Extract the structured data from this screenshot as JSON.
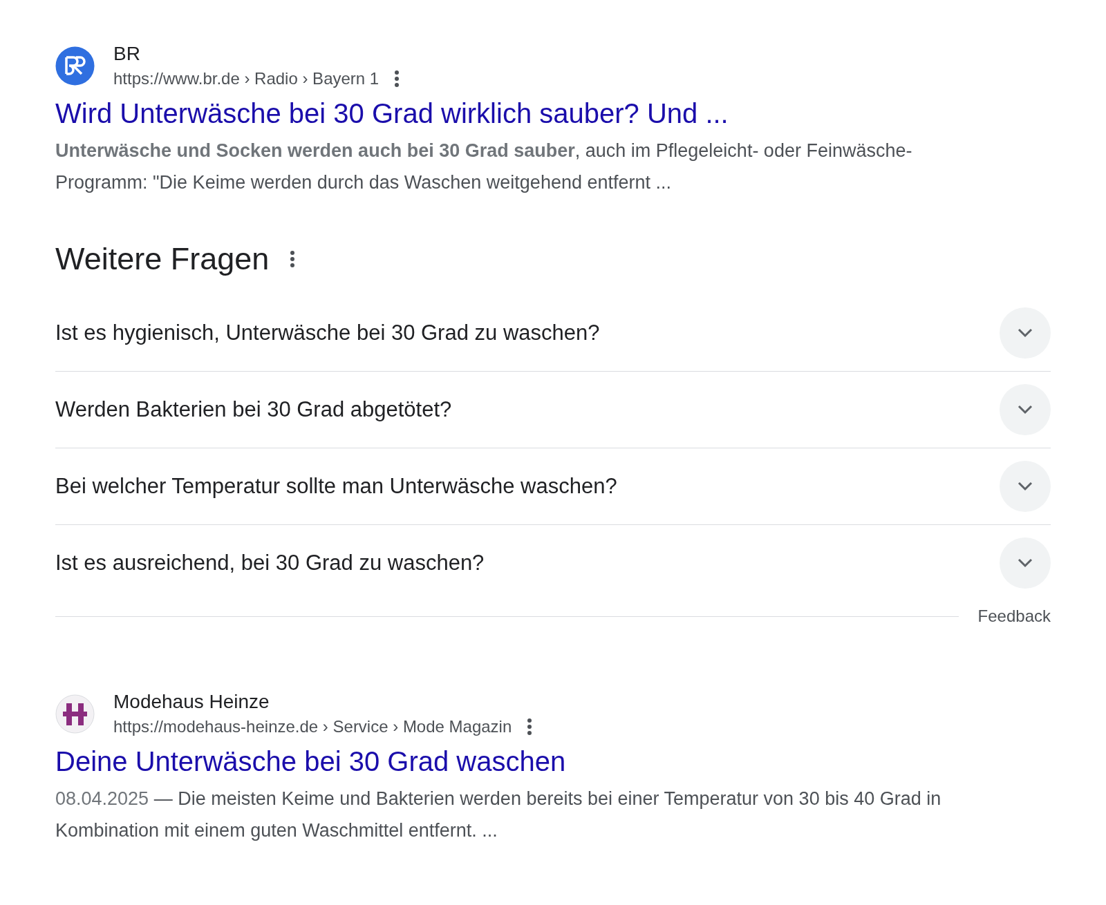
{
  "results_top": [
    {
      "kind": "br",
      "site": "BR",
      "url": "https://www.br.de › Radio › Bayern 1",
      "title": "Wird Unterwäsche bei 30 Grad wirklich sauber? Und ...",
      "snippet": "**Unterwäsche und Socken werden auch bei 30 Grad sauber**, auch im Pflegeleicht- oder Feinwäsche-Programm: \"Die Keime werden durch das Waschen weitgehend entfernt ..."
    }
  ],
  "questions": {
    "heading": "Weitere Fragen",
    "items": [
      {
        "text": "Ist es hygienisch, Unterwäsche bei 30 Grad zu waschen?",
        "expanded": false
      },
      {
        "text": "Werden Bakterien bei 30 Grad abgetötet?",
        "expanded": false
      },
      {
        "text": "Bei welcher Temperatur sollte man Unterwäsche waschen?",
        "expanded": false
      },
      {
        "text": "Ist es ausreichend, bei 30 Grad zu waschen?",
        "expanded": false
      }
    ],
    "feedback": "Feedback"
  },
  "results_bottom": [
    {
      "kind": "heinze",
      "site": "Modehaus Heinze",
      "url": "https://modehaus-heinze.de › Service › Mode Magazin",
      "title": "Deine Unterwäsche bei 30 Grad waschen",
      "date": "08.04.2025",
      "snippet": " — Die meisten Keime und Bakterien werden bereits bei einer Temperatur von 30 bis 40 Grad in Kombination mit einem guten Waschmittel entfernt. ..."
    }
  ]
}
